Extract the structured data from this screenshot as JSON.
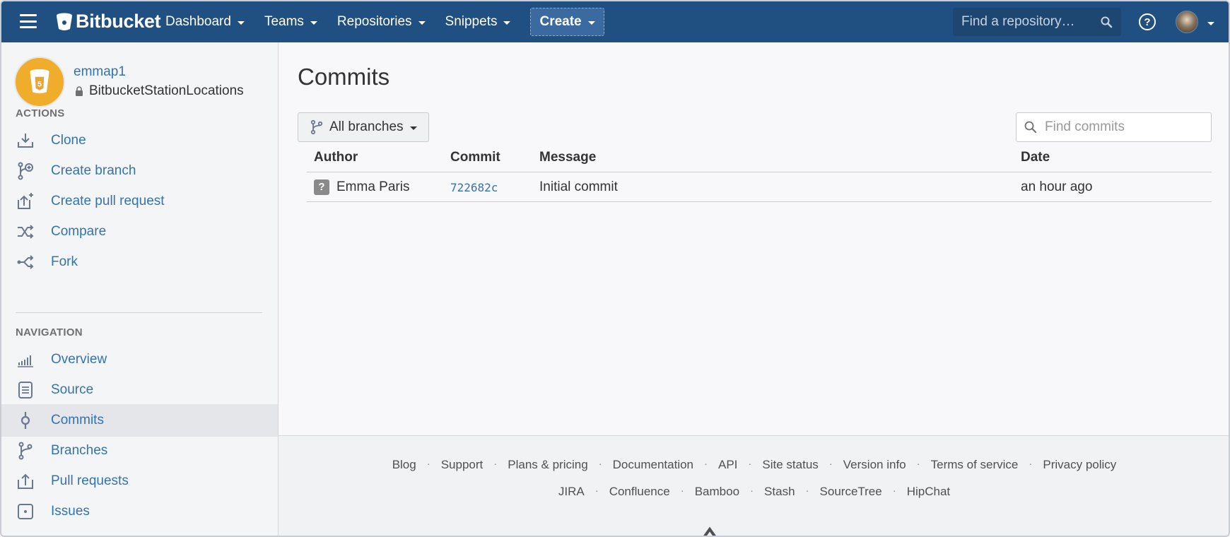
{
  "header": {
    "logo_text": "Bitbucket",
    "nav": [
      {
        "label": "Dashboard"
      },
      {
        "label": "Teams"
      },
      {
        "label": "Repositories"
      },
      {
        "label": "Snippets"
      }
    ],
    "create_label": "Create",
    "search_placeholder": "Find a repository…",
    "help_glyph": "?",
    "accent_color": "#205081"
  },
  "sidebar": {
    "owner": "emmap1",
    "repo_name": "BitbucketStationLocations",
    "actions_label": "ACTIONS",
    "actions": [
      {
        "label": "Clone",
        "icon": "clone-icon"
      },
      {
        "label": "Create branch",
        "icon": "create-branch-icon"
      },
      {
        "label": "Create pull request",
        "icon": "create-pull-request-icon"
      },
      {
        "label": "Compare",
        "icon": "compare-icon"
      },
      {
        "label": "Fork",
        "icon": "fork-icon"
      }
    ],
    "navigation_label": "NAVIGATION",
    "navigation": [
      {
        "label": "Overview",
        "icon": "overview-icon"
      },
      {
        "label": "Source",
        "icon": "source-icon"
      },
      {
        "label": "Commits",
        "icon": "commits-icon",
        "active": true
      },
      {
        "label": "Branches",
        "icon": "branches-icon"
      },
      {
        "label": "Pull requests",
        "icon": "pull-requests-icon"
      },
      {
        "label": "Issues",
        "icon": "issues-icon"
      }
    ]
  },
  "main": {
    "title": "Commits",
    "branch_filter": "All branches",
    "find_placeholder": "Find commits",
    "columns": [
      "Author",
      "Commit",
      "Message",
      "Date"
    ],
    "rows": [
      {
        "author": "Emma Paris",
        "avatar_glyph": "?",
        "commit": "722682c",
        "message": "Initial commit",
        "date": "an hour ago"
      }
    ]
  },
  "footer": {
    "links_row1": [
      "Blog",
      "Support",
      "Plans & pricing",
      "Documentation",
      "API",
      "Site status",
      "Version info",
      "Terms of service",
      "Privacy policy"
    ],
    "links_row2": [
      "JIRA",
      "Confluence",
      "Bamboo",
      "Stash",
      "SourceTree",
      "HipChat"
    ],
    "separator": "·"
  }
}
